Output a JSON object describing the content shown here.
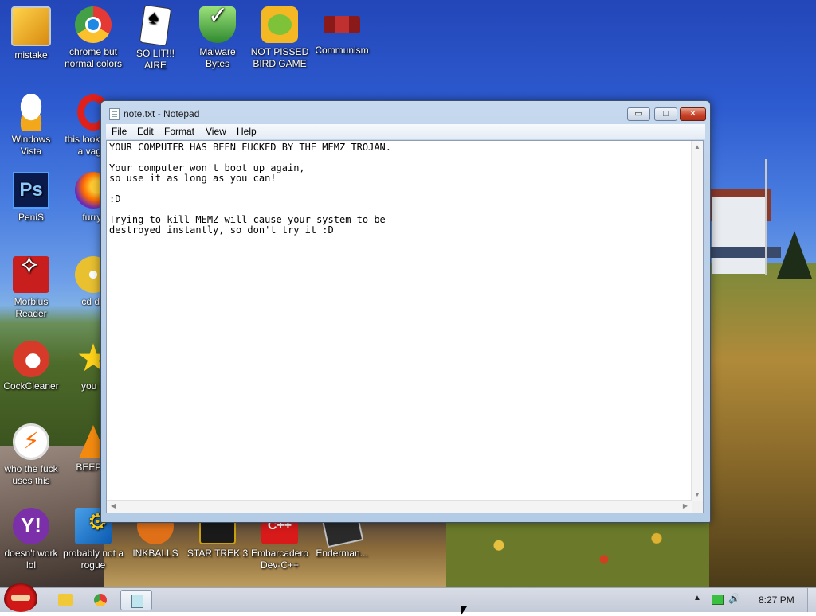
{
  "desktop_icons": [
    {
      "label": "mistake",
      "icon": "computer-icon"
    },
    {
      "label": "chrome but normal colors",
      "icon": "chrome-icon"
    },
    {
      "label": "SO LIT!!! AIRE",
      "icon": "solitaire-icon"
    },
    {
      "label": "Malware Bytes",
      "icon": "shield-icon"
    },
    {
      "label": "NOT PISSED BIRD GAME",
      "icon": "pig-icon"
    },
    {
      "label": "Communism",
      "icon": "emblem-icon"
    },
    {
      "label": "Windows Vista",
      "icon": "egg-icon"
    },
    {
      "label": "this looks like a vagin",
      "icon": "opera-icon"
    },
    {
      "label": "PeniS",
      "icon": "photoshop-icon"
    },
    {
      "label": "furryf",
      "icon": "firefox-icon"
    },
    {
      "label": "Morbius Reader",
      "icon": "pdf-icon"
    },
    {
      "label": "cd dri",
      "icon": "cd-icon"
    },
    {
      "label": "CockCleaner",
      "icon": "ccleaner-icon"
    },
    {
      "label": "you tr",
      "icon": "star-icon"
    },
    {
      "label": "who the fuck uses this",
      "icon": "bolt-icon"
    },
    {
      "label": "BEEP B",
      "icon": "traffic-cone-icon"
    },
    {
      "label": "doesn't work lol",
      "icon": "yahoo-icon"
    },
    {
      "label": "probably not a rogue",
      "icon": "gears-icon"
    },
    {
      "label": "INKBALLS",
      "icon": "inkball-icon"
    },
    {
      "label": "STAR TREK 3",
      "icon": "star-trek-icon"
    },
    {
      "label": "Embarcadero Dev-C++",
      "icon": "devcpp-icon"
    },
    {
      "label": "Enderman...",
      "icon": "enderman-icon"
    }
  ],
  "notepad": {
    "title": "note.txt - Notepad",
    "menus": [
      "File",
      "Edit",
      "Format",
      "View",
      "Help"
    ],
    "content": "YOUR COMPUTER HAS BEEN FUCKED BY THE MEMZ TROJAN.\n\nYour computer won't boot up again,\nso use it as long as you can!\n\n:D\n\nTrying to kill MEMZ will cause your system to be\ndestroyed instantly, so don't try it :D",
    "buttons": {
      "minimize": "▭",
      "maximize": "□",
      "close": "✕"
    }
  },
  "taskbar": {
    "clock": "8:27 PM",
    "apps": [
      "start-orb-icon",
      "explorer-icon",
      "chrome-icon",
      "notepad-icon"
    ],
    "tray": {
      "show_hidden": "▲",
      "volume": "🔊"
    }
  },
  "colors": {
    "window_frame": "#bcd0e8",
    "close_button": "#c8442a",
    "taskbar": "#c4cbd8"
  }
}
